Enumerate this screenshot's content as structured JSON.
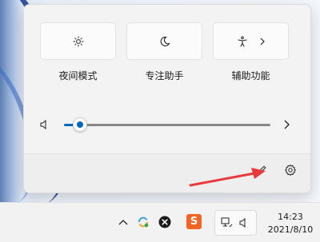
{
  "quick_settings": {
    "tiles": [
      {
        "label": "夜间模式",
        "icon": "brightness-sun-icon"
      },
      {
        "label": "专注助手",
        "icon": "moon-focus-icon"
      },
      {
        "label": "辅助功能",
        "icon": "accessibility-icon"
      }
    ],
    "volume": {
      "level": 0.08,
      "icon": "speaker-icon"
    },
    "footer_icons": [
      "edit-pencil-icon",
      "settings-gear-icon"
    ]
  },
  "taskbar": {
    "tray_icons": [
      "chevron-up-icon",
      "sync-app-icon",
      "close-circle-app-icon",
      "sogou-input-icon",
      "network-icon",
      "speaker-icon"
    ],
    "ime_label": "S",
    "clock_time": "14:23",
    "clock_date": "2021/8/10"
  },
  "colors": {
    "accent": "#0067c0",
    "annotation_arrow": "#e8393c",
    "ime_orange": "#f26522"
  }
}
